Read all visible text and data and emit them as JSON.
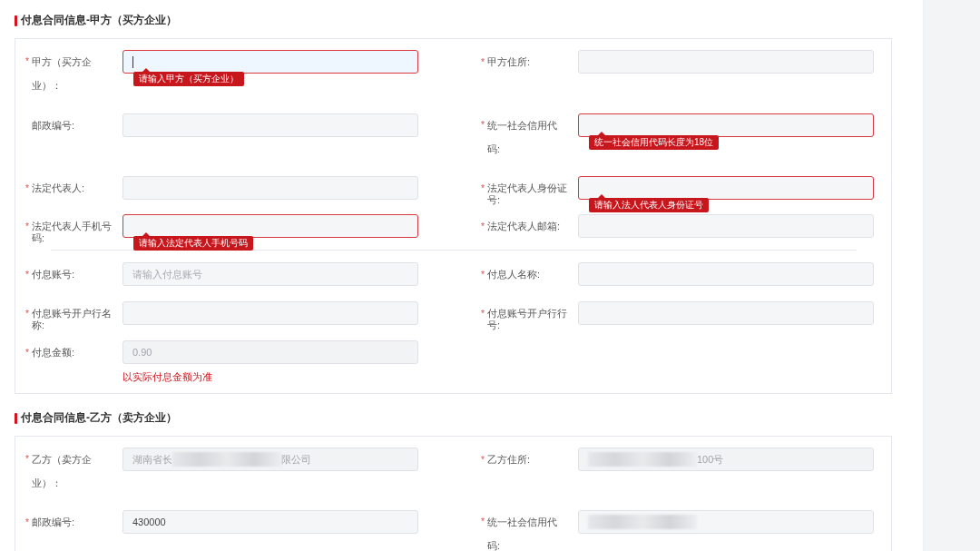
{
  "sections": [
    {
      "title": "付息合同信息-甲方（买方企业）",
      "rows": [
        {
          "kind": "fields",
          "fields": [
            {
              "mark": "*",
              "label": "甲方（买方企业）：",
              "focused": true,
              "error": "请输入甲方（买方企业）"
            },
            {
              "mark": "*",
              "label": "甲方住所:"
            }
          ]
        },
        {
          "kind": "fields",
          "fields": [
            {
              "label": "邮政编号:"
            },
            {
              "mark": "*",
              "label": "统一社会信用代码:",
              "error": "统一社会信用代码长度为18位"
            }
          ]
        },
        {
          "kind": "fields",
          "fields": [
            {
              "mark": "*",
              "label": "法定代表人:"
            },
            {
              "mark": "*",
              "label": "法定代表人身份证号:",
              "error": "请输入法人代表人身份证号"
            }
          ]
        },
        {
          "kind": "fields",
          "fields": [
            {
              "mark": "*",
              "label": "法定代表人手机号码:",
              "error": "请输入法定代表人手机号码"
            },
            {
              "mark": "*",
              "label": "法定代表人邮箱:"
            }
          ]
        },
        {
          "kind": "divider"
        },
        {
          "kind": "fields",
          "fields": [
            {
              "mark": "*",
              "label": "付息账号:",
              "placeholder": "请输入付息账号"
            },
            {
              "mark": "*",
              "label": "付息人名称:"
            }
          ]
        },
        {
          "kind": "fields",
          "fields": [
            {
              "mark": "*",
              "label": "付息账号开户行名称:"
            },
            {
              "mark": "*",
              "label": "付息账号开户行行号:"
            }
          ]
        },
        {
          "kind": "fields",
          "fields": [
            {
              "mark": "*",
              "label": "付息金额:",
              "disabled": true,
              "value": [
                {
                  "kind": "text",
                  "text": "0.90"
                }
              ],
              "hint": "以实际付息金额为准"
            }
          ]
        }
      ]
    },
    {
      "title": "付息合同信息-乙方（卖方企业）",
      "rows": [
        {
          "kind": "fields",
          "fields": [
            {
              "mark": "*",
              "label": "乙方（卖方企业）：",
              "disabled": true,
              "value": [
                {
                  "kind": "text",
                  "text": "湖南省长"
                },
                {
                  "kind": "blur"
                },
                {
                  "kind": "text",
                  "text": "限公司"
                }
              ]
            },
            {
              "mark": "*",
              "label": "乙方住所:",
              "disabled": true,
              "value": [
                {
                  "kind": "blur"
                },
                {
                  "kind": "text",
                  "text": "100号"
                }
              ]
            }
          ]
        },
        {
          "kind": "fields",
          "fields": [
            {
              "mark": "*",
              "label": "邮政编号:",
              "value": [
                {
                  "kind": "text",
                  "text": "430000"
                }
              ]
            },
            {
              "mark": "*",
              "label": "统一社会信用代码:",
              "value": [
                {
                  "kind": "blur"
                }
              ]
            }
          ]
        }
      ]
    }
  ]
}
